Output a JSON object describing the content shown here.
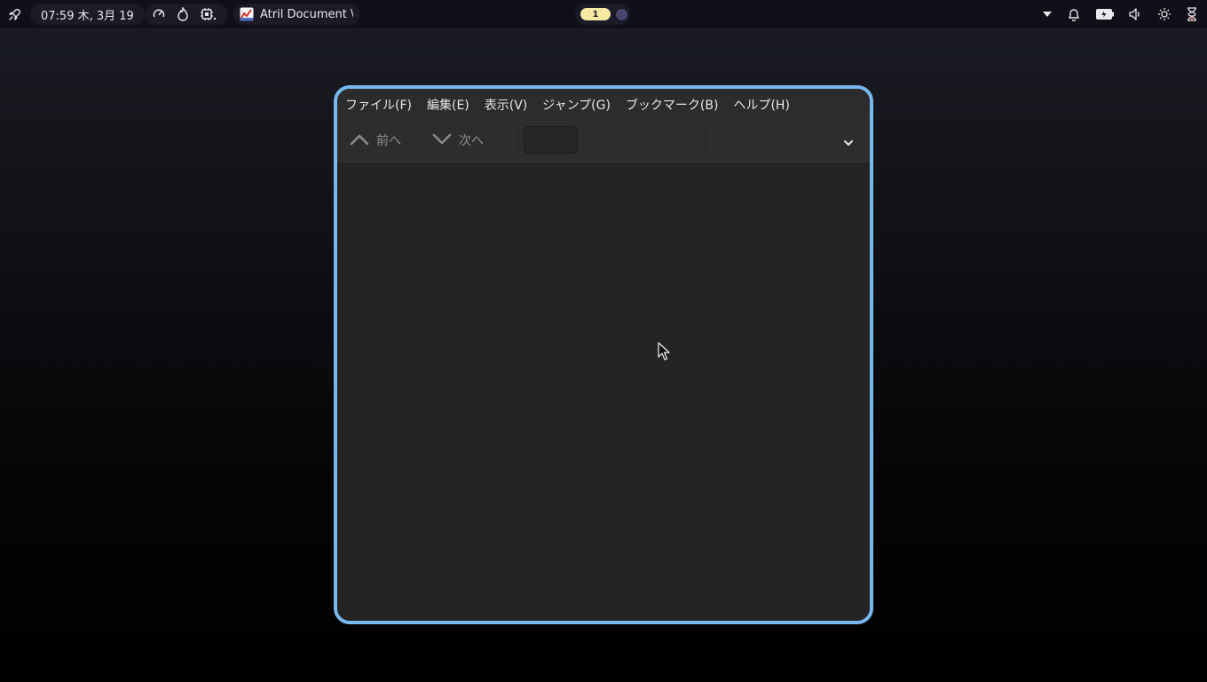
{
  "topbar": {
    "clock": "07:59 木, 3月 19",
    "task": {
      "title": "Atril Document \\"
    },
    "workspace": {
      "active": "1"
    },
    "icons": [
      "launcher-icon",
      "gauge-icon",
      "flame-icon",
      "cpu-icon",
      "dropdown-arrow-icon",
      "bell-icon",
      "battery-icon",
      "volume-icon",
      "brightness-icon",
      "hourglass-icon"
    ]
  },
  "window": {
    "menubar": {
      "items": [
        "ファイル(F)",
        "編集(E)",
        "表示(V)",
        "ジャンプ(G)",
        "ブックマーク(B)",
        "ヘルプ(H)"
      ]
    },
    "toolbar": {
      "prev_label": "前へ",
      "next_label": "次へ",
      "page_value": ""
    },
    "colors": {
      "border": "#79b8ef",
      "background": "#242424"
    }
  }
}
